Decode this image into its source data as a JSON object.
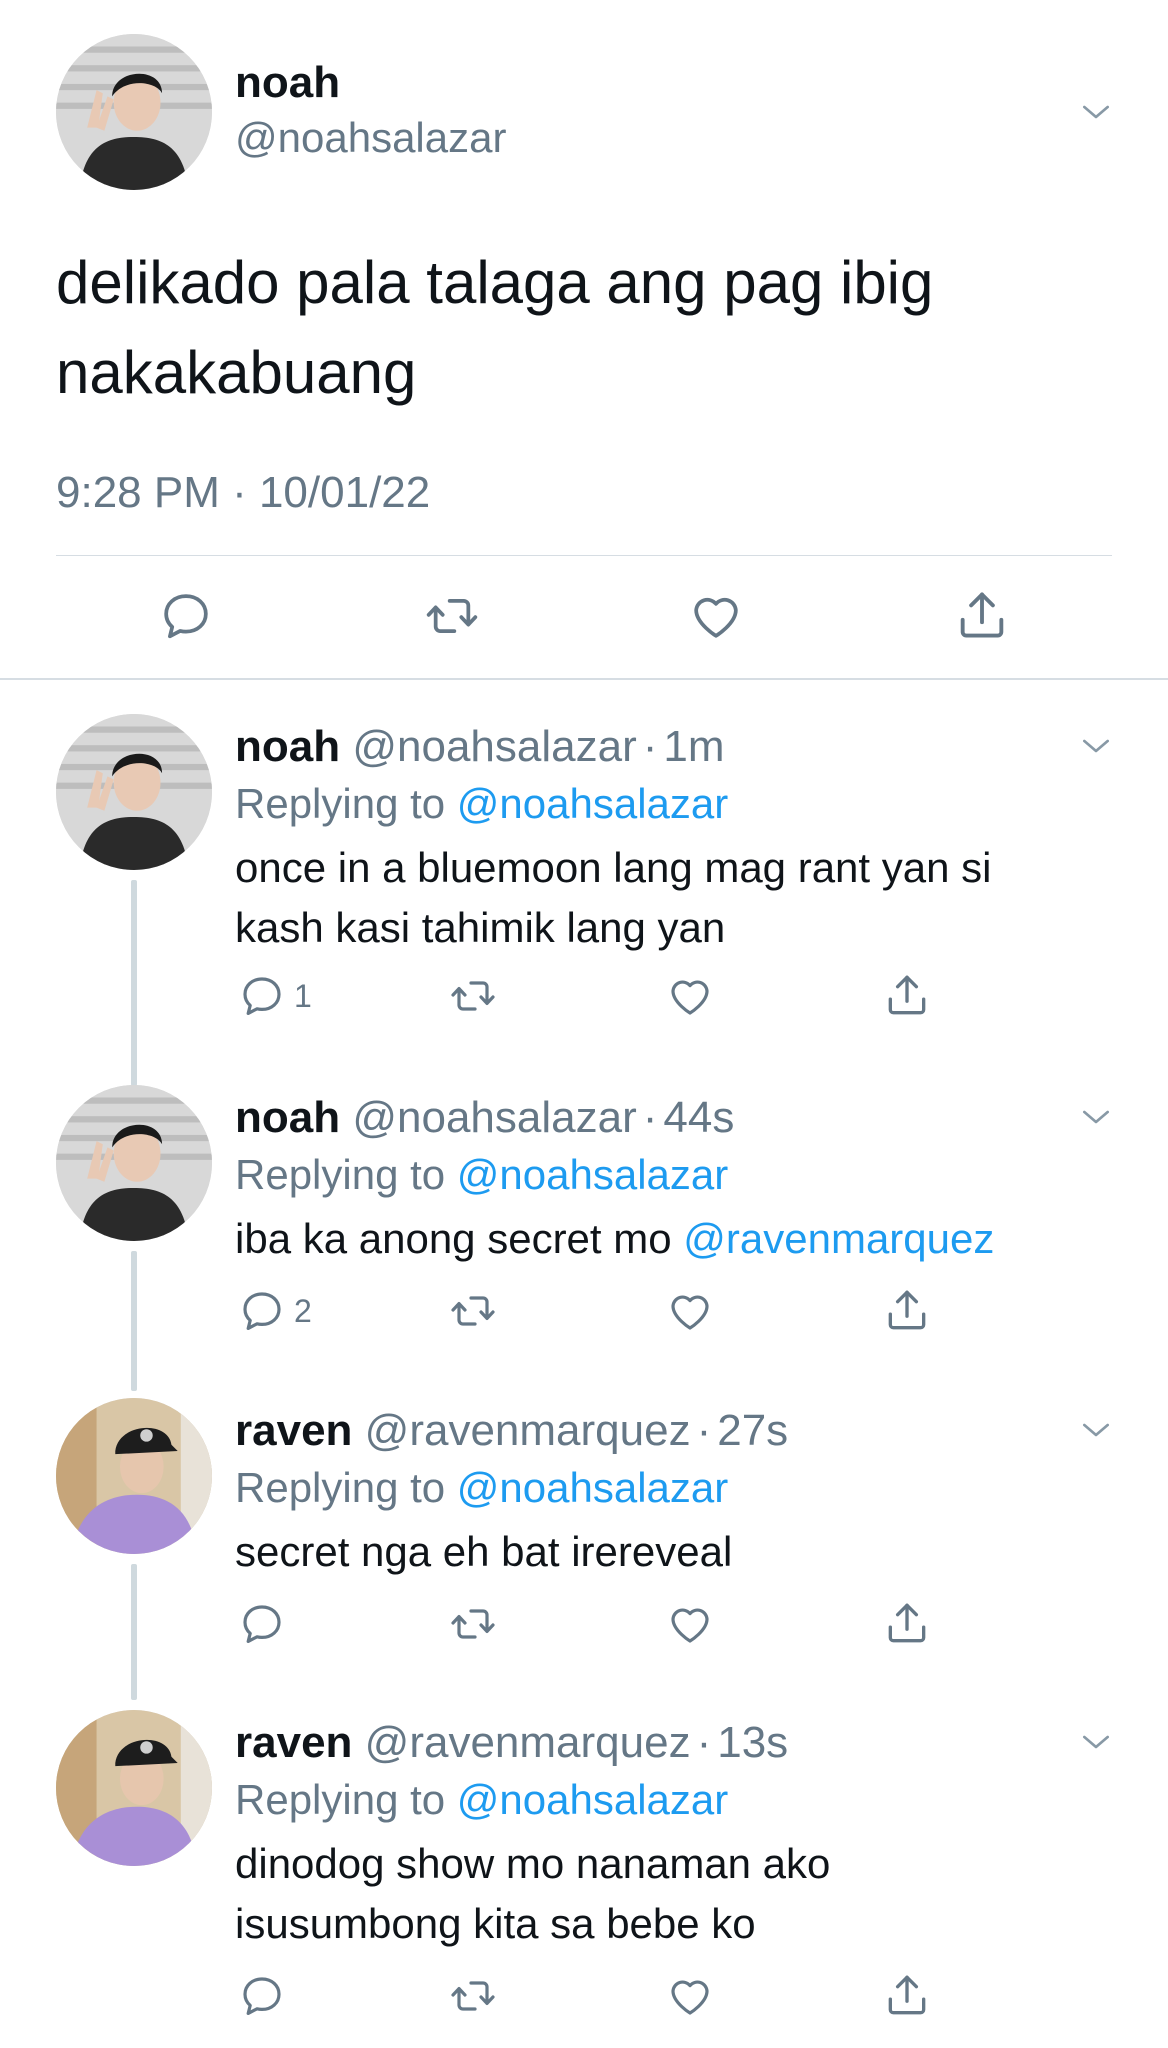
{
  "main_tweet": {
    "name": "noah",
    "handle": "@noahsalazar",
    "text_line1": "delikado pala talaga ang pag ibig",
    "text_line2": "nakakabuang",
    "timestamp": "9:28 PM · 10/01/22",
    "actions": [
      "reply-icon",
      "retweet-icon",
      "like-icon",
      "share-icon"
    ]
  },
  "replies": [
    {
      "name": "noah",
      "handle": "@noahsalazar",
      "dot": "·",
      "time": "1m",
      "replying_prefix": "Replying to",
      "replying_to": "@noahsalazar",
      "text_line1": "once in a bluemoon lang mag rant yan si",
      "text_line2": "kash kasi tahimik lang yan",
      "reply_count": "1"
    },
    {
      "name": "noah",
      "handle": "@noahsalazar",
      "dot": "·",
      "time": "44s",
      "replying_prefix": "Replying to",
      "replying_to": "@noahsalazar",
      "text_plain": "iba ka anong secret mo ",
      "text_mention": "@ravenmarquez",
      "reply_count": "2"
    },
    {
      "name": "raven",
      "handle": "@ravenmarquez",
      "dot": "·",
      "time": "27s",
      "replying_prefix": "Replying to",
      "replying_to": "@noahsalazar",
      "text_line1": "secret nga eh bat irereveal",
      "reply_count": ""
    },
    {
      "name": "raven",
      "handle": "@ravenmarquez",
      "dot": "·",
      "time": "13s",
      "replying_prefix": "Replying to",
      "replying_to": "@noahsalazar",
      "text_line1": "dinodog show mo nanaman ako",
      "text_line2": "isusumbong kita sa bebe ko",
      "reply_count": ""
    }
  ],
  "colors": {
    "text": "#0f1419",
    "secondary": "#657786",
    "link": "#1d9bf0",
    "divider": "#d6dde3",
    "thread_line": "#cfd9de"
  }
}
